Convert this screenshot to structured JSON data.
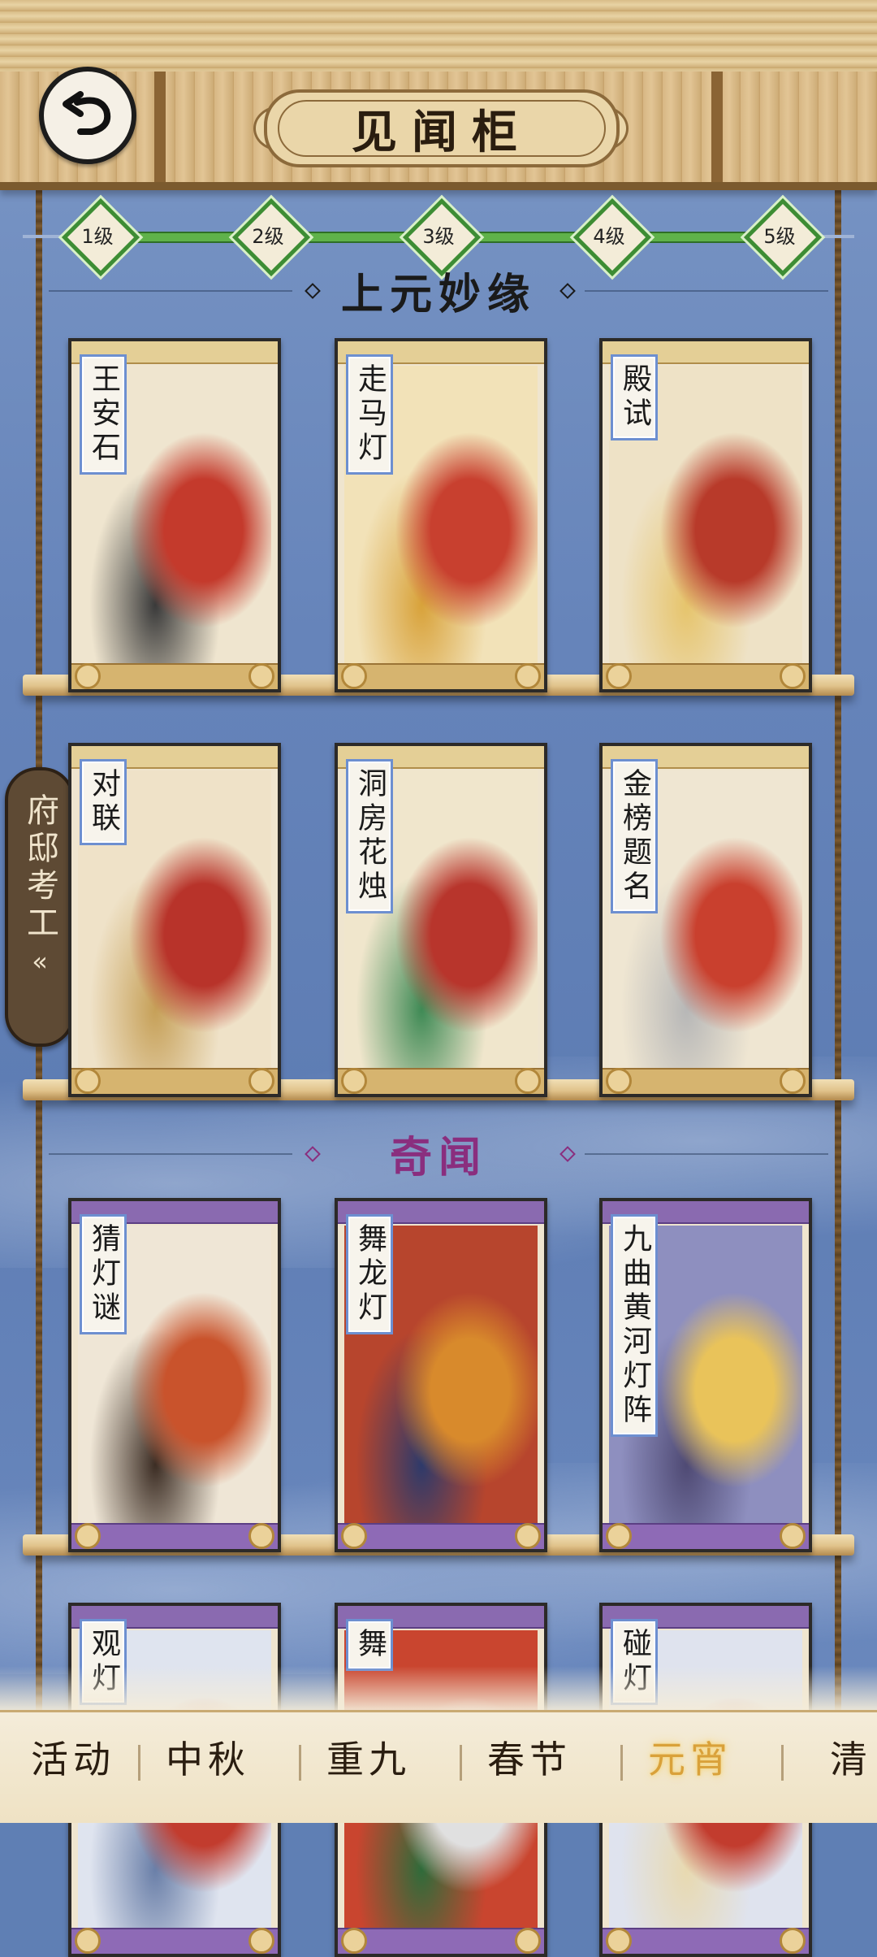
{
  "header": {
    "title": "见闻柜",
    "back_icon": "back-arrow-icon"
  },
  "levels": [
    "1级",
    "2级",
    "3级",
    "4级",
    "5级"
  ],
  "sections": [
    {
      "title": "上元妙缘",
      "color": "#1a1a1a",
      "rows": [
        [
          {
            "name": "王安石"
          },
          {
            "name": "走马灯"
          },
          {
            "name": "殿试"
          }
        ],
        [
          {
            "name": "对联"
          },
          {
            "name": "洞房花烛"
          },
          {
            "name": "金榜题名"
          }
        ]
      ]
    },
    {
      "title": "奇闻",
      "color": "#8a2e7e",
      "rows": [
        [
          {
            "name": "猜灯谜"
          },
          {
            "name": "舞龙灯"
          },
          {
            "name": "九曲黄河灯阵"
          }
        ],
        [
          {
            "name": "观灯"
          },
          {
            "name": "舞"
          },
          {
            "name": "碰灯"
          }
        ]
      ]
    }
  ],
  "side_tab": {
    "label": "府邸考工",
    "chevron": "«"
  },
  "bottom_nav": {
    "items": [
      "活动",
      "中秋",
      "重九",
      "春节",
      "元宵",
      "清"
    ],
    "active": "元宵"
  },
  "colors": {
    "accent_green": "#5fb24a",
    "active_tab": "#d9a13a",
    "bg_blue": "#6684ba"
  }
}
